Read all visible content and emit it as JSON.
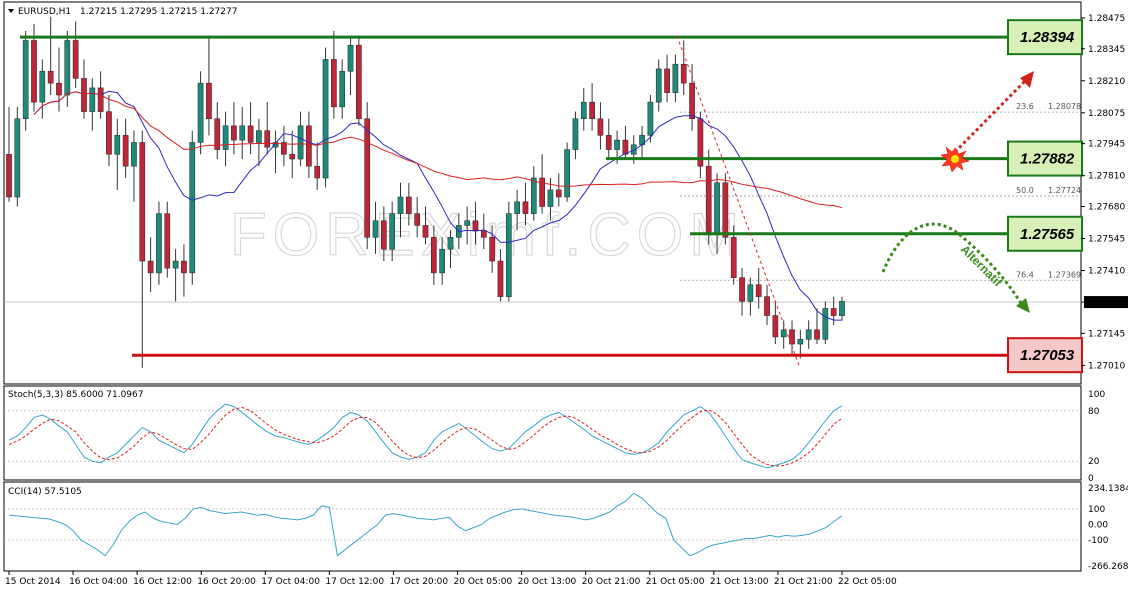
{
  "header": {
    "symbol": "EURUSD,H1",
    "ohlc": "1.27215 1.27295 1.27215 1.27277"
  },
  "watermark": "FOREXimf.COM",
  "colors": {
    "bull": "#1f8a7a",
    "bear": "#c0263a",
    "ma_fast": "#2a2ac0",
    "ma_slow": "#d62020",
    "resistance": "#1a7a1a",
    "support": "#cc1111",
    "stoch_main": "#3aa6c8",
    "stoch_signal": "#e02020",
    "cci": "#3aa6c8",
    "level_box_green": "#d8f0b8",
    "level_box_red": "#f6c8c8"
  },
  "chart_data": {
    "type": "candlestick",
    "title": "EURUSD,H1",
    "price_axis": {
      "ylim": [
        1.2694,
        1.285
      ],
      "ticks": [
        "1.28475",
        "1.28345",
        "1.28210",
        "1.28075",
        "1.27945",
        "1.27810",
        "1.27680",
        "1.27545",
        "1.27410",
        "1.27277",
        "1.27145",
        "1.27010"
      ],
      "current_price": "1.27277"
    },
    "x_ticks": [
      "15 Oct 2014",
      "16 Oct 04:00",
      "16 Oct 12:00",
      "16 Oct 20:00",
      "17 Oct 04:00",
      "17 Oct 12:00",
      "17 Oct 20:00",
      "20 Oct 05:00",
      "20 Oct 13:00",
      "20 Oct 21:00",
      "21 Oct 05:00",
      "21 Oct 13:00",
      "21 Oct 21:00",
      "22 Oct 05:00"
    ],
    "levels": [
      {
        "label": "1.28394",
        "value": 1.28394,
        "kind": "resistance"
      },
      {
        "label": "1.27882",
        "value": 1.27882,
        "kind": "resistance"
      },
      {
        "label": "1.27565",
        "value": 1.27565,
        "kind": "resistance"
      },
      {
        "label": "1.27053",
        "value": 1.27053,
        "kind": "support"
      }
    ],
    "fibo": [
      {
        "ratio": "23.6",
        "price": "1.28078"
      },
      {
        "ratio": "50.0",
        "price": "1.27724"
      },
      {
        "ratio": "76.4",
        "price": "1.27369"
      }
    ],
    "annotation": "Alternatif",
    "candles": [
      [
        1.279,
        1.281,
        1.277,
        1.2772
      ],
      [
        1.2772,
        1.281,
        1.2768,
        1.2805
      ],
      [
        1.2805,
        1.2842,
        1.28,
        1.2838
      ],
      [
        1.2838,
        1.2845,
        1.2808,
        1.2812
      ],
      [
        1.2812,
        1.283,
        1.2805,
        1.2825
      ],
      [
        1.2825,
        1.2848,
        1.2815,
        1.282
      ],
      [
        1.282,
        1.2835,
        1.2808,
        1.2815
      ],
      [
        1.2815,
        1.2842,
        1.281,
        1.2838
      ],
      [
        1.2838,
        1.2846,
        1.2818,
        1.2822
      ],
      [
        1.2822,
        1.283,
        1.2805,
        1.2808
      ],
      [
        1.2808,
        1.2822,
        1.28,
        1.2818
      ],
      [
        1.2818,
        1.2825,
        1.2805,
        1.2808
      ],
      [
        1.2808,
        1.2815,
        1.2785,
        1.279
      ],
      [
        1.279,
        1.2805,
        1.2775,
        1.2798
      ],
      [
        1.2798,
        1.2805,
        1.278,
        1.2785
      ],
      [
        1.2785,
        1.28,
        1.277,
        1.2795
      ],
      [
        1.2795,
        1.28,
        1.27,
        1.2745
      ],
      [
        1.2745,
        1.2755,
        1.2732,
        1.274
      ],
      [
        1.274,
        1.277,
        1.2735,
        1.2765
      ],
      [
        1.2765,
        1.277,
        1.2738,
        1.2742
      ],
      [
        1.2742,
        1.275,
        1.2728,
        1.2745
      ],
      [
        1.2745,
        1.2752,
        1.273,
        1.274
      ],
      [
        1.274,
        1.28,
        1.2735,
        1.2795
      ],
      [
        1.2795,
        1.2825,
        1.279,
        1.282
      ],
      [
        1.282,
        1.284,
        1.2798,
        1.2805
      ],
      [
        1.2805,
        1.2812,
        1.2788,
        1.2792
      ],
      [
        1.2792,
        1.2808,
        1.2785,
        1.2802
      ],
      [
        1.2802,
        1.2812,
        1.279,
        1.2796
      ],
      [
        1.2796,
        1.281,
        1.2788,
        1.2802
      ],
      [
        1.2802,
        1.2812,
        1.279,
        1.2795
      ],
      [
        1.2795,
        1.2805,
        1.2785,
        1.28
      ],
      [
        1.28,
        1.2812,
        1.279,
        1.2793
      ],
      [
        1.2793,
        1.28,
        1.2782,
        1.2795
      ],
      [
        1.2795,
        1.2802,
        1.2785,
        1.279
      ],
      [
        1.279,
        1.28,
        1.278,
        1.2788
      ],
      [
        1.2788,
        1.2808,
        1.2785,
        1.2802
      ],
      [
        1.2802,
        1.2808,
        1.278,
        1.2785
      ],
      [
        1.2785,
        1.2795,
        1.2775,
        1.278
      ],
      [
        1.278,
        1.2835,
        1.2776,
        1.283
      ],
      [
        1.283,
        1.2842,
        1.2805,
        1.281
      ],
      [
        1.281,
        1.283,
        1.2805,
        1.2825
      ],
      [
        1.2825,
        1.284,
        1.2815,
        1.2836
      ],
      [
        1.2836,
        1.284,
        1.2802,
        1.2805
      ],
      [
        1.2805,
        1.2812,
        1.275,
        1.2755
      ],
      [
        1.2755,
        1.277,
        1.2748,
        1.2762
      ],
      [
        1.2762,
        1.2768,
        1.2745,
        1.275
      ],
      [
        1.275,
        1.277,
        1.2745,
        1.2765
      ],
      [
        1.2765,
        1.2778,
        1.2755,
        1.2772
      ],
      [
        1.2772,
        1.2778,
        1.276,
        1.2765
      ],
      [
        1.2765,
        1.2772,
        1.2755,
        1.276
      ],
      [
        1.276,
        1.2768,
        1.2752,
        1.2755
      ],
      [
        1.2755,
        1.276,
        1.2735,
        1.274
      ],
      [
        1.274,
        1.2755,
        1.2735,
        1.275
      ],
      [
        1.275,
        1.2758,
        1.2742,
        1.2755
      ],
      [
        1.2755,
        1.2765,
        1.275,
        1.276
      ],
      [
        1.276,
        1.2768,
        1.2752,
        1.2762
      ],
      [
        1.2762,
        1.277,
        1.2752,
        1.2758
      ],
      [
        1.2758,
        1.2765,
        1.275,
        1.2755
      ],
      [
        1.2755,
        1.276,
        1.274,
        1.2745
      ],
      [
        1.2745,
        1.275,
        1.2728,
        1.273
      ],
      [
        1.273,
        1.277,
        1.2728,
        1.2765
      ],
      [
        1.2765,
        1.2775,
        1.2758,
        1.277
      ],
      [
        1.277,
        1.2778,
        1.276,
        1.2765
      ],
      [
        1.2765,
        1.2785,
        1.2762,
        1.278
      ],
      [
        1.278,
        1.279,
        1.2765,
        1.2768
      ],
      [
        1.2768,
        1.278,
        1.2762,
        1.2775
      ],
      [
        1.2775,
        1.2782,
        1.2768,
        1.2772
      ],
      [
        1.2772,
        1.2795,
        1.277,
        1.2792
      ],
      [
        1.2792,
        1.2808,
        1.2788,
        1.2805
      ],
      [
        1.2805,
        1.2818,
        1.28,
        1.2812
      ],
      [
        1.2812,
        1.282,
        1.28,
        1.2805
      ],
      [
        1.2805,
        1.2812,
        1.2792,
        1.2798
      ],
      [
        1.2798,
        1.2805,
        1.2788,
        1.2792
      ],
      [
        1.2792,
        1.28,
        1.2786,
        1.2796
      ],
      [
        1.2796,
        1.2802,
        1.2788,
        1.279
      ],
      [
        1.279,
        1.2798,
        1.2786,
        1.2794
      ],
      [
        1.2794,
        1.2802,
        1.2788,
        1.2798
      ],
      [
        1.2798,
        1.2815,
        1.2795,
        1.2812
      ],
      [
        1.2812,
        1.283,
        1.2808,
        1.2826
      ],
      [
        1.2826,
        1.2832,
        1.2812,
        1.2816
      ],
      [
        1.2816,
        1.2832,
        1.2812,
        1.2828
      ],
      [
        1.2828,
        1.2838,
        1.2815,
        1.282
      ],
      [
        1.282,
        1.2828,
        1.28,
        1.2805
      ],
      [
        1.2805,
        1.2808,
        1.278,
        1.2785
      ],
      [
        1.2785,
        1.2792,
        1.2752,
        1.2756
      ],
      [
        1.2756,
        1.2782,
        1.2748,
        1.2778
      ],
      [
        1.2778,
        1.2782,
        1.2752,
        1.2755
      ],
      [
        1.2755,
        1.276,
        1.2735,
        1.2738
      ],
      [
        1.2738,
        1.2742,
        1.2722,
        1.2728
      ],
      [
        1.2728,
        1.2738,
        1.2722,
        1.2735
      ],
      [
        1.2735,
        1.2742,
        1.2725,
        1.273
      ],
      [
        1.273,
        1.2735,
        1.2718,
        1.2722
      ],
      [
        1.2722,
        1.2728,
        1.271,
        1.2713
      ],
      [
        1.2713,
        1.272,
        1.2708,
        1.2716
      ],
      [
        1.2716,
        1.272,
        1.2705,
        1.271
      ],
      [
        1.271,
        1.2716,
        1.2704,
        1.2712
      ],
      [
        1.2712,
        1.272,
        1.2708,
        1.2716
      ],
      [
        1.2716,
        1.2725,
        1.271,
        1.2712
      ],
      [
        1.2712,
        1.2728,
        1.271,
        1.2725
      ],
      [
        1.2725,
        1.273,
        1.2718,
        1.2722
      ],
      [
        1.2722,
        1.273,
        1.272,
        1.2728
      ]
    ]
  },
  "stoch": {
    "label": "Stoch(5,3,3) 85.6000 71.0967",
    "ticks": [
      "100",
      "80",
      "20",
      "0"
    ],
    "main": [
      45,
      50,
      60,
      72,
      75,
      70,
      62,
      55,
      40,
      25,
      20,
      18,
      25,
      30,
      40,
      50,
      60,
      55,
      45,
      40,
      35,
      30,
      40,
      55,
      70,
      80,
      88,
      85,
      78,
      70,
      62,
      55,
      50,
      48,
      45,
      42,
      40,
      45,
      52,
      60,
      72,
      78,
      75,
      68,
      55,
      42,
      30,
      25,
      22,
      25,
      30,
      45,
      55,
      60,
      65,
      58,
      50,
      42,
      35,
      32,
      35,
      45,
      55,
      62,
      70,
      75,
      78,
      72,
      65,
      58,
      50,
      45,
      40,
      35,
      30,
      28,
      30,
      35,
      42,
      55,
      65,
      75,
      80,
      85,
      78,
      65,
      50,
      35,
      22,
      18,
      15,
      12,
      15,
      18,
      22,
      30,
      42,
      55,
      68,
      80,
      86
    ],
    "signal": [
      40,
      44,
      50,
      58,
      65,
      70,
      68,
      62,
      55,
      42,
      32,
      24,
      22,
      24,
      30,
      38,
      48,
      55,
      52,
      46,
      40,
      35,
      34,
      42,
      52,
      64,
      75,
      82,
      84,
      80,
      72,
      64,
      57,
      52,
      48,
      45,
      43,
      42,
      45,
      50,
      58,
      67,
      72,
      72,
      66,
      56,
      44,
      34,
      27,
      24,
      26,
      33,
      42,
      50,
      57,
      60,
      58,
      52,
      45,
      38,
      34,
      36,
      43,
      51,
      60,
      67,
      72,
      74,
      71,
      65,
      58,
      51,
      46,
      40,
      35,
      31,
      30,
      32,
      37,
      45,
      55,
      64,
      72,
      79,
      81,
      76,
      66,
      53,
      40,
      28,
      21,
      16,
      14,
      15,
      18,
      23,
      30,
      40,
      52,
      64,
      71
    ]
  },
  "cci": {
    "label": "CCI(14) 57.5105",
    "ticks": [
      "234.1384",
      "100",
      "0.00",
      "-100",
      "-266.2684"
    ],
    "values": [
      60,
      55,
      50,
      45,
      40,
      35,
      20,
      0,
      -40,
      -100,
      -130,
      -160,
      -200,
      -130,
      -40,
      20,
      60,
      80,
      40,
      20,
      10,
      0,
      40,
      100,
      110,
      90,
      80,
      70,
      75,
      80,
      70,
      60,
      65,
      50,
      40,
      35,
      30,
      40,
      60,
      120,
      110,
      -200,
      -160,
      -120,
      -80,
      -40,
      0,
      60,
      70,
      60,
      50,
      40,
      35,
      30,
      40,
      45,
      -10,
      -40,
      -20,
      0,
      40,
      60,
      80,
      95,
      100,
      90,
      80,
      70,
      60,
      55,
      50,
      40,
      30,
      40,
      60,
      80,
      120,
      150,
      200,
      170,
      120,
      70,
      40,
      -100,
      -150,
      -200,
      -180,
      -150,
      -130,
      -120,
      -110,
      -100,
      -90,
      -90,
      -80,
      -70,
      -80,
      -70,
      -75,
      -70,
      -60,
      -40,
      -20,
      20,
      57
    ]
  }
}
